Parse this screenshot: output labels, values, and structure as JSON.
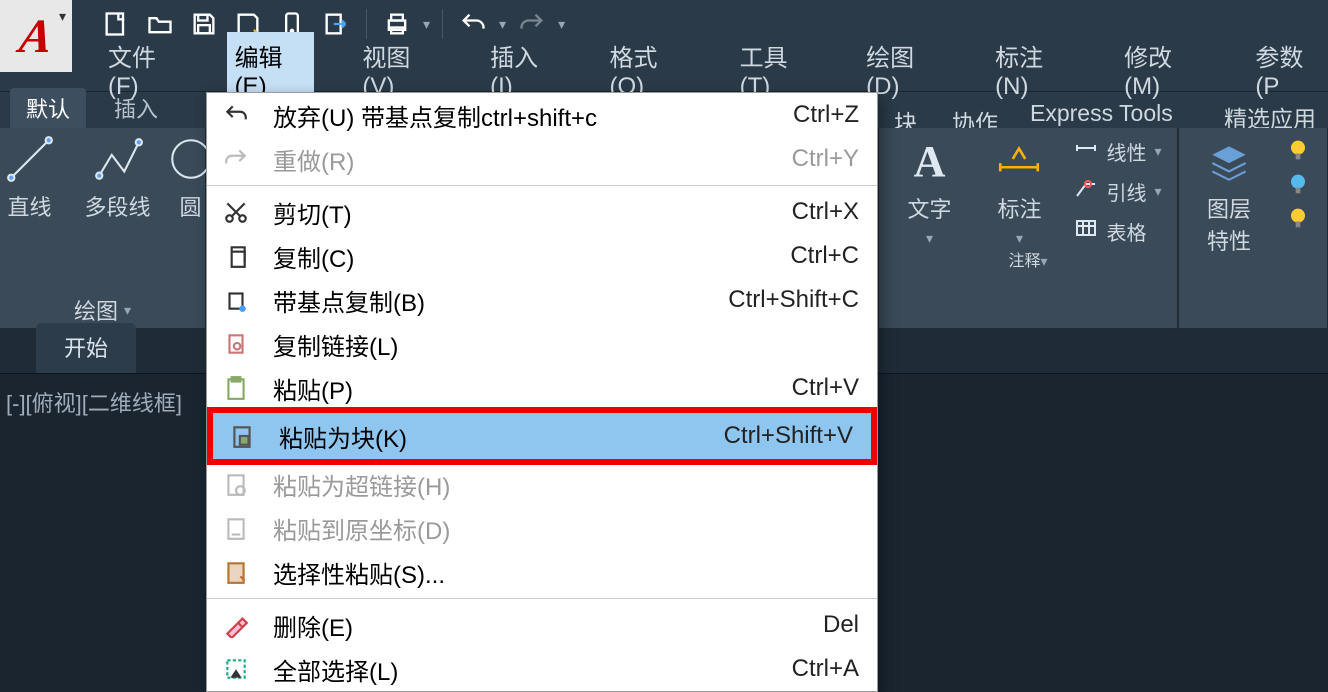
{
  "qat": {
    "icons": [
      "new",
      "open",
      "save",
      "saveall",
      "mobile",
      "export",
      "print",
      "undo",
      "redo"
    ]
  },
  "menubar": {
    "items": [
      "文件(F)",
      "编辑(E)",
      "视图(V)",
      "插入(I)",
      "格式(O)",
      "工具(T)",
      "绘图(D)",
      "标注(N)",
      "修改(M)",
      "参数(P"
    ],
    "activeIndex": 1
  },
  "ribbonTabs": {
    "left": [
      "默认",
      "插入"
    ],
    "leftActive": 0,
    "rightVisible": [
      "块",
      "协作",
      "Express Tools",
      "精选应用"
    ]
  },
  "drawPanel": {
    "label": "绘图",
    "tools": [
      {
        "name": "直线",
        "icon": "line"
      },
      {
        "name": "多段线",
        "icon": "polyline"
      },
      {
        "name": "圆",
        "icon": "circle"
      }
    ]
  },
  "annotationPanel": {
    "label": "注释",
    "textBtn": "文字",
    "dimBtn": "标注",
    "tools": [
      "线性",
      "引线",
      "表格"
    ]
  },
  "layerPanel": {
    "btn": "图层\n特性"
  },
  "docTabs": {
    "start": "开始"
  },
  "viewportLabel": "[-][俯视][二维线框]",
  "editMenu": {
    "items": [
      {
        "icon": "undo",
        "label": "放弃(U) 带基点复制ctrl+shift+c",
        "shortcut": "Ctrl+Z",
        "disabled": false
      },
      {
        "icon": "redo",
        "label": "重做(R)",
        "shortcut": "Ctrl+Y",
        "disabled": true
      },
      {
        "sep": true
      },
      {
        "icon": "cut",
        "label": "剪切(T)",
        "shortcut": "Ctrl+X",
        "disabled": false
      },
      {
        "icon": "copy",
        "label": "复制(C)",
        "shortcut": "Ctrl+C",
        "disabled": false
      },
      {
        "icon": "copybase",
        "label": "带基点复制(B)",
        "shortcut": "Ctrl+Shift+C",
        "disabled": false
      },
      {
        "icon": "copylink",
        "label": "复制链接(L)",
        "shortcut": "",
        "disabled": false
      },
      {
        "icon": "paste",
        "label": "粘贴(P)",
        "shortcut": "Ctrl+V",
        "disabled": false
      },
      {
        "icon": "pasteblock",
        "label": "粘贴为块(K)",
        "shortcut": "Ctrl+Shift+V",
        "disabled": false,
        "highlight": true
      },
      {
        "icon": "pastelink",
        "label": "粘贴为超链接(H)",
        "shortcut": "",
        "disabled": true
      },
      {
        "icon": "pasteorig",
        "label": "粘贴到原坐标(D)",
        "shortcut": "",
        "disabled": true
      },
      {
        "icon": "pastespec",
        "label": "选择性粘贴(S)...",
        "shortcut": "",
        "disabled": false
      },
      {
        "sep": true
      },
      {
        "icon": "erase",
        "label": "删除(E)",
        "shortcut": "Del",
        "disabled": false
      },
      {
        "icon": "selectall",
        "label": "全部选择(L)",
        "shortcut": "Ctrl+A",
        "disabled": false
      }
    ]
  }
}
